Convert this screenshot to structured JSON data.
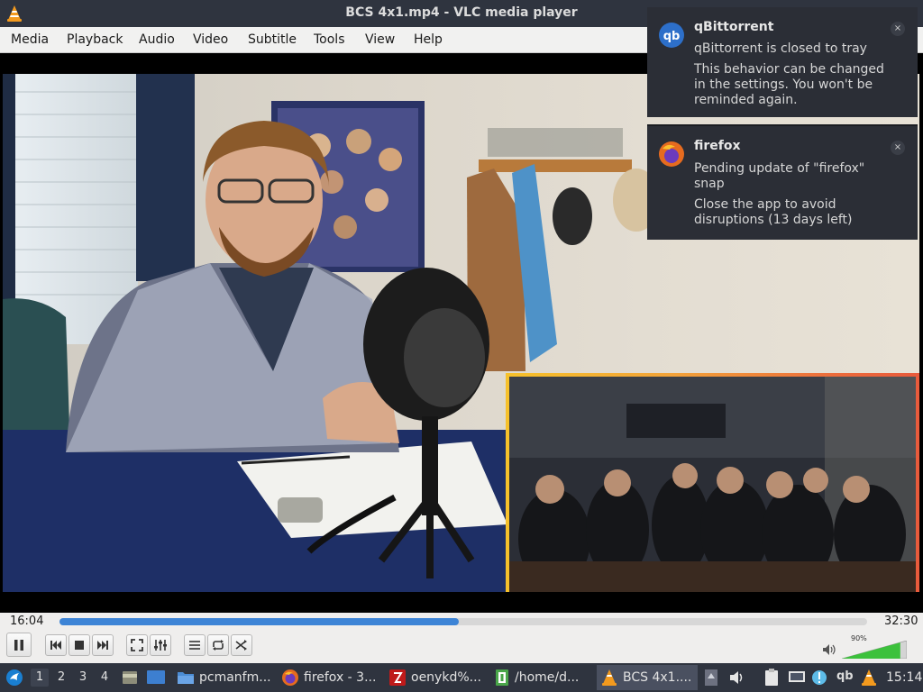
{
  "window": {
    "title": "BCS 4x1.mp4 - VLC media player",
    "icon": "vlc-cone-icon"
  },
  "menu": [
    "Media",
    "Playback",
    "Audio",
    "Video",
    "Subtitle",
    "Tools",
    "View",
    "Help"
  ],
  "player": {
    "elapsed": "16:04",
    "duration": "32:30",
    "progress": 0.494,
    "volume_label": "90%",
    "volume": 0.9
  },
  "controls": {
    "buttons": [
      "pause-icon",
      "previous-icon",
      "stop-icon",
      "next-icon",
      "fullscreen-icon",
      "extended-settings-icon",
      "playlist-icon",
      "loop-icon",
      "shuffle-icon",
      "volume-icon"
    ]
  },
  "taskbar": {
    "workspaces": [
      "1",
      "2",
      "3",
      "4"
    ],
    "tasks": [
      {
        "label": "pcmanfm...",
        "icon": "folder-icon"
      },
      {
        "label": "firefox - 3...",
        "icon": "firefox-icon"
      },
      {
        "label": "oenykd%...",
        "icon": "filezilla-icon"
      },
      {
        "label": "/home/d...",
        "icon": "terminal-icon"
      },
      {
        "label": "BCS 4x1....",
        "icon": "vlc-cone-icon"
      }
    ],
    "clock": "15:14",
    "tray_qb": "qb"
  },
  "notifications": [
    {
      "app": "qBittorrent",
      "summary": "qBittorrent is closed to tray",
      "body_lines": [
        "This behavior can be changed",
        "in the settings. You won't be",
        "reminded again."
      ],
      "icon": "qbittorrent-icon",
      "close": "×"
    },
    {
      "app": "firefox",
      "summary_lines": [
        "Pending update of \"firefox\"",
        "snap"
      ],
      "body_lines": [
        "Close the app to avoid",
        "disruptions (13 days left)"
      ],
      "icon": "firefox-icon",
      "close": "×"
    }
  ],
  "colors": {
    "accent": "#3d84d6",
    "titlebar": "#2f343f",
    "pip_border_start": "#f6c12b",
    "pip_border_end": "#e85b3c",
    "volume_green": "#3cc13c"
  }
}
